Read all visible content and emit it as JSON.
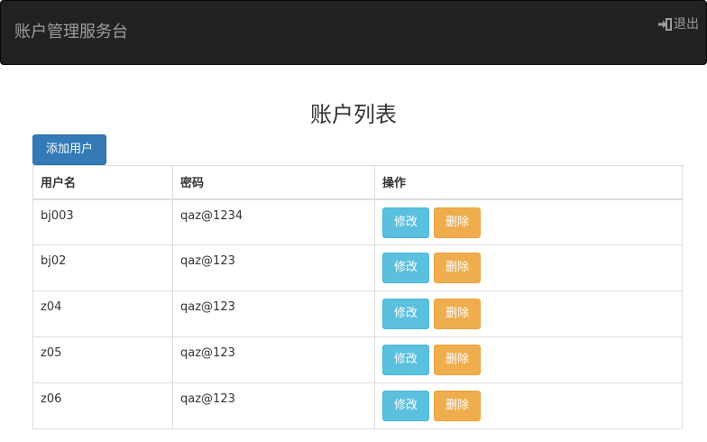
{
  "header": {
    "brand": "账户管理服务台",
    "logout_label": "退出",
    "logout_icon": "sign-out-icon"
  },
  "main": {
    "title": "账户列表",
    "add_button_label": "添加用户",
    "table": {
      "columns": [
        "用户名",
        "密码",
        "操作"
      ],
      "rows": [
        {
          "username": "bj003",
          "password": "qaz@1234"
        },
        {
          "username": "bj02",
          "password": "qaz@123"
        },
        {
          "username": "z04",
          "password": "qaz@123"
        },
        {
          "username": "z05",
          "password": "qaz@123"
        },
        {
          "username": "z06",
          "password": "qaz@123"
        }
      ],
      "edit_label": "修改",
      "delete_label": "删除"
    }
  },
  "colors": {
    "navbar_bg": "#222222",
    "primary": "#337ab7",
    "info": "#5bc0de",
    "warning": "#f0ad4e"
  }
}
